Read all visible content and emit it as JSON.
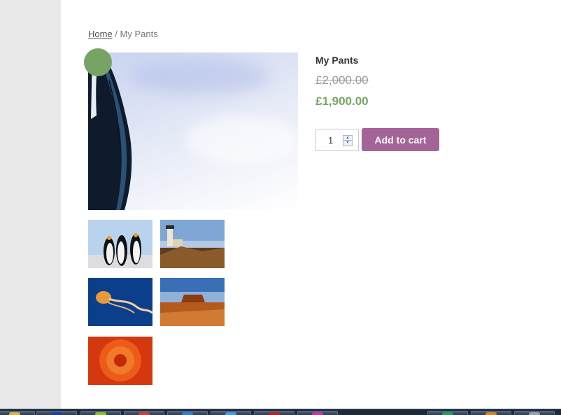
{
  "breadcrumb": {
    "home_label": "Home",
    "separator": " / ",
    "current": "My Pants"
  },
  "product": {
    "title": "My Pants",
    "regular_price": "£2,000.00",
    "sale_price": "£1,900.00",
    "quantity": "1",
    "add_to_cart_label": "Add to cart"
  },
  "colors": {
    "sale_price": "#77a464",
    "button": "#a46497",
    "taskbar": "#1d2a3a"
  },
  "gallery": {
    "main_image": "penguin-closeup",
    "thumbnails": [
      "penguins",
      "lighthouse",
      "jellyfish",
      "desert",
      "chrysanthemum"
    ]
  },
  "taskbar": {
    "icons": [
      "folder-icon",
      "monitor-icon",
      "terminal-icon",
      "chrome-icon",
      "ie-icon",
      "cloud-icon",
      "calendar-icon",
      "pink-app-icon",
      "green-app-icon",
      "cone-icon",
      "gear-icon"
    ]
  }
}
